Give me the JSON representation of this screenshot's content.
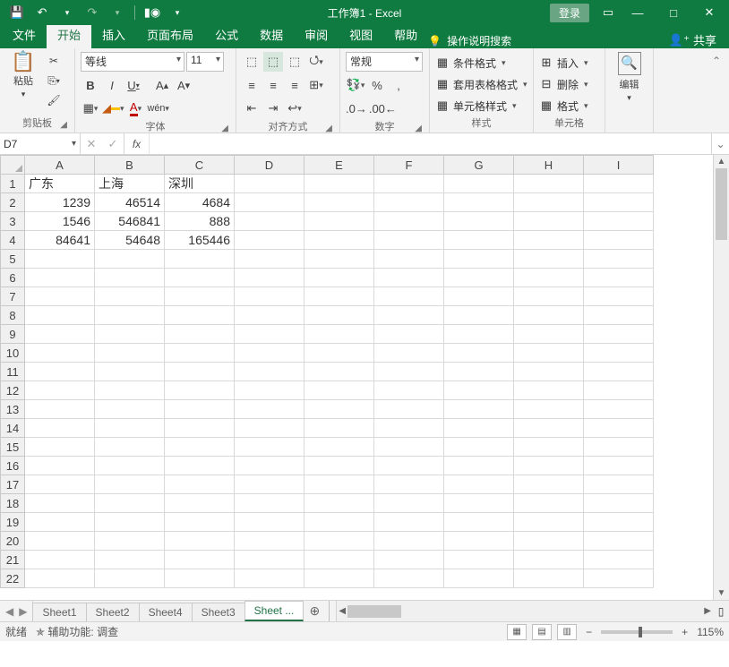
{
  "title": "工作簿1 - Excel",
  "login": "登录",
  "tabs": {
    "file": "文件",
    "home": "开始",
    "insert": "插入",
    "layout": "页面布局",
    "formulas": "公式",
    "data": "数据",
    "review": "审阅",
    "view": "视图",
    "help": "帮助",
    "search": "操作说明搜索",
    "share": "共享"
  },
  "ribbon": {
    "clipboard": {
      "paste": "粘贴",
      "label": "剪贴板"
    },
    "font": {
      "name": "等线",
      "size": "11",
      "label": "字体"
    },
    "align": {
      "label": "对齐方式"
    },
    "number": {
      "format": "常规",
      "label": "数字"
    },
    "styles": {
      "cond": "条件格式",
      "table": "套用表格格式",
      "cell": "单元格样式",
      "label": "样式"
    },
    "cells": {
      "insert": "插入",
      "delete": "删除",
      "format": "格式",
      "label": "单元格"
    },
    "editing": {
      "edit": "编辑"
    }
  },
  "namebox": "D7",
  "columns": [
    "A",
    "B",
    "C",
    "D",
    "E",
    "F",
    "G",
    "H",
    "I"
  ],
  "rows": [
    "1",
    "2",
    "3",
    "4",
    "5",
    "6",
    "7",
    "8",
    "9",
    "10",
    "11",
    "12",
    "13",
    "14",
    "15",
    "16",
    "17",
    "18",
    "19",
    "20",
    "21",
    "22"
  ],
  "chart_data": {
    "type": "table",
    "headers": [
      "广东",
      "上海",
      "深圳"
    ],
    "data": [
      [
        1239,
        46514,
        4684
      ],
      [
        1546,
        546841,
        888
      ],
      [
        84641,
        54648,
        165446
      ]
    ]
  },
  "sheets": [
    "Sheet1",
    "Sheet2",
    "Sheet4",
    "Sheet3",
    "Sheet ..."
  ],
  "active_sheet": 4,
  "status": {
    "ready": "就绪",
    "access": "辅助功能: 调查",
    "zoom": "115%"
  }
}
